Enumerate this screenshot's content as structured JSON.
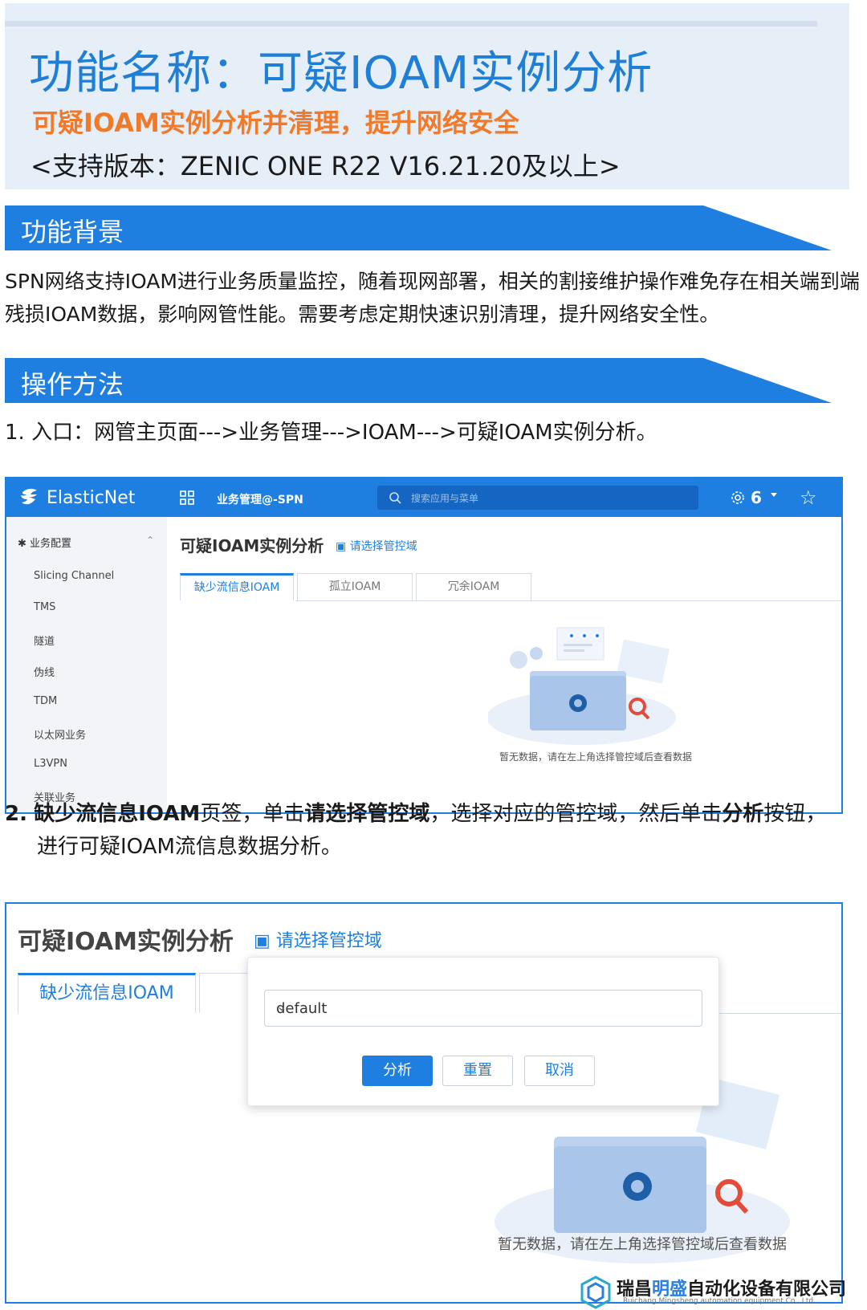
{
  "header": {
    "title": "功能名称：可疑IOAM实例分析",
    "subtitle": "可疑IOAM实例分析并清理，提升网络安全",
    "version": "<支持版本：ZENIC ONE R22 V16.21.20及以上>"
  },
  "section_background": {
    "heading": "功能背景",
    "body": "SPN网络支持IOAM进行业务质量监控，随着现网部署，相关的割接维护操作难免存在相关端到端残损IOAM数据，影响网管性能。需要考虑定期快速识别清理，提升网络安全性。"
  },
  "section_method": {
    "heading": "操作方法",
    "step1": "1.  入口：网管主页面--->业务管理--->IOAM--->可疑IOAM实例分析。",
    "step2": {
      "num": "2.",
      "b1": "缺少流信息IOAM",
      "t1": "页签，单击",
      "b2": "请选择管控域",
      "t2": "，选择对应的管控域，然后单击",
      "b3": "分析",
      "t3": "按钮，",
      "t4": "进行可疑IOAM流信息数据分析。"
    }
  },
  "screenshot1": {
    "brand": "ElasticNet",
    "module": "业务管理@-SPN",
    "search_placeholder": "搜索应用与菜单",
    "notif_count": "6",
    "sidebar_group": "业务配置",
    "sidebar_items": [
      "Slicing Channel",
      "TMS",
      "隧道",
      "伪线",
      "TDM",
      "以太网业务",
      "L3VPN",
      "关联业务"
    ],
    "page_title": "可疑IOAM实例分析",
    "domain_link": "请选择管控域",
    "tabs": [
      "缺少流信息IOAM",
      "孤立IOAM",
      "冗余IOAM"
    ],
    "empty_text": "暂无数据，请在左上角选择管控域后查看数据"
  },
  "screenshot2": {
    "page_title": "可疑IOAM实例分析",
    "domain_link": "请选择管控域",
    "tab_active": "缺少流信息IOAM",
    "select_value": "default",
    "btn_analyze": "分析",
    "btn_reset": "重置",
    "btn_cancel": "取消",
    "empty_text": "暂无数据，请在左上角选择管控域后查看数据"
  },
  "footer": {
    "company_cn_1": "瑞昌",
    "company_cn_2": "明盛",
    "company_cn_3": "自动化设备有限公司",
    "company_en": "Ruichang Mingsheng automation equipment Co., Ltd"
  },
  "colors": {
    "primary": "#1e7fe0",
    "title_blue": "#1f7fd6",
    "accent_orange": "#f07a2a",
    "hero_bg": "#e6eef8"
  }
}
